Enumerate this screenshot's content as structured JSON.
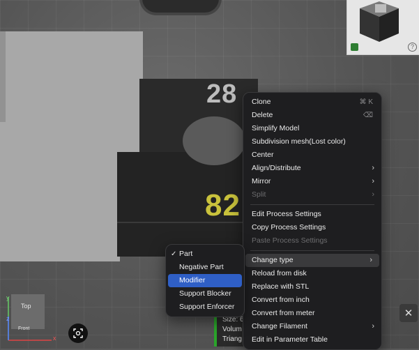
{
  "scene": {
    "label_top": "28",
    "label_bottom": "82"
  },
  "context_menu": {
    "items": [
      {
        "label": "Clone",
        "shortcut": "⌘ K"
      },
      {
        "label": "Delete",
        "shortcut": "⌫"
      },
      {
        "label": "Simplify Model"
      },
      {
        "label": "Subdivision mesh(Lost color)"
      },
      {
        "label": "Center"
      },
      {
        "label": "Align/Distribute",
        "submenu": true
      },
      {
        "label": "Mirror",
        "submenu": true
      },
      {
        "label": "Split",
        "submenu": true,
        "disabled": true
      },
      {
        "label": "Edit Process Settings"
      },
      {
        "label": "Copy Process Settings"
      },
      {
        "label": "Paste Process Settings",
        "disabled": true
      },
      {
        "label": "Change type",
        "submenu": true,
        "active": true
      },
      {
        "label": "Reload from disk"
      },
      {
        "label": "Replace with STL"
      },
      {
        "label": "Convert from inch"
      },
      {
        "label": "Convert from meter"
      },
      {
        "label": "Change Filament",
        "submenu": true
      },
      {
        "label": "Edit in Parameter Table"
      }
    ]
  },
  "change_type_submenu": {
    "items": [
      {
        "label": "Part",
        "checked": true,
        "checkmark": "✓"
      },
      {
        "label": "Negative Part"
      },
      {
        "label": "Modifier",
        "selected": true
      },
      {
        "label": "Support Blocker"
      },
      {
        "label": "Support Enforcer"
      }
    ]
  },
  "view_cube": {
    "top": "Top",
    "front": "Front",
    "axis_x": "x",
    "axis_y": "y",
    "axis_z": "z"
  },
  "info_panel": {
    "size": "Size: 6",
    "volume": "Volum",
    "triangles": "Triang"
  },
  "help_glyph": "?",
  "close_glyph": "✕",
  "colors": {
    "menu_bg": "#1e1e20",
    "selected": "#2f5fc6",
    "status_green": "#2aa52a"
  },
  "icons": [
    "help-icon",
    "cube-icon",
    "screenshot-icon",
    "close-icon",
    "chevron-right-icon"
  ]
}
